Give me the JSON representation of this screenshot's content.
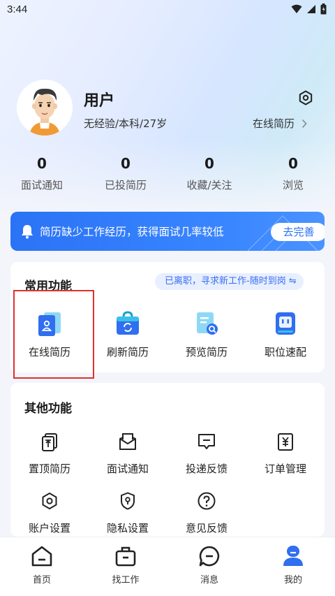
{
  "status_bar": {
    "time": "3:44",
    "icons": [
      "wifi-icon",
      "signal-icon",
      "battery-icon"
    ]
  },
  "profile": {
    "name": "用户",
    "info": "无经验/本科/27岁",
    "online_resume_link": "在线简历"
  },
  "stats": [
    {
      "value": "0",
      "label": "面试通知"
    },
    {
      "value": "0",
      "label": "已投简历"
    },
    {
      "value": "0",
      "label": "收藏/关注"
    },
    {
      "value": "0",
      "label": "浏览"
    }
  ],
  "tip": {
    "text": "简历缺少工作经历，获得面试几率较低",
    "button": "去完善"
  },
  "common": {
    "title": "常用功能",
    "job_status": "已离职，寻求新工作-随时到岗 ⇋",
    "items": [
      {
        "label": "在线简历",
        "icon": "resume-card-icon"
      },
      {
        "label": "刷新简历",
        "icon": "refresh-bag-icon"
      },
      {
        "label": "预览简历",
        "icon": "preview-search-icon"
      },
      {
        "label": "职位速配",
        "icon": "job-match-icon"
      }
    ]
  },
  "other": {
    "title": "其他功能",
    "items": [
      {
        "label": "置顶简历",
        "icon": "pin-top-icon"
      },
      {
        "label": "面试通知",
        "icon": "envelope-icon"
      },
      {
        "label": "投递反馈",
        "icon": "feedback-chat-icon"
      },
      {
        "label": "订单管理",
        "icon": "order-yen-icon"
      },
      {
        "label": "账户设置",
        "icon": "hex-settings-icon"
      },
      {
        "label": "隐私设置",
        "icon": "privacy-shield-icon"
      },
      {
        "label": "意见反馈",
        "icon": "question-icon"
      }
    ]
  },
  "tabs": [
    {
      "label": "首页",
      "icon": "home-icon"
    },
    {
      "label": "找工作",
      "icon": "briefcase-icon"
    },
    {
      "label": "消息",
      "icon": "message-icon"
    },
    {
      "label": "我的",
      "icon": "profile-icon",
      "active": true
    }
  ],
  "colors": {
    "accent": "#2a73f6",
    "highlight": "#e03030"
  }
}
